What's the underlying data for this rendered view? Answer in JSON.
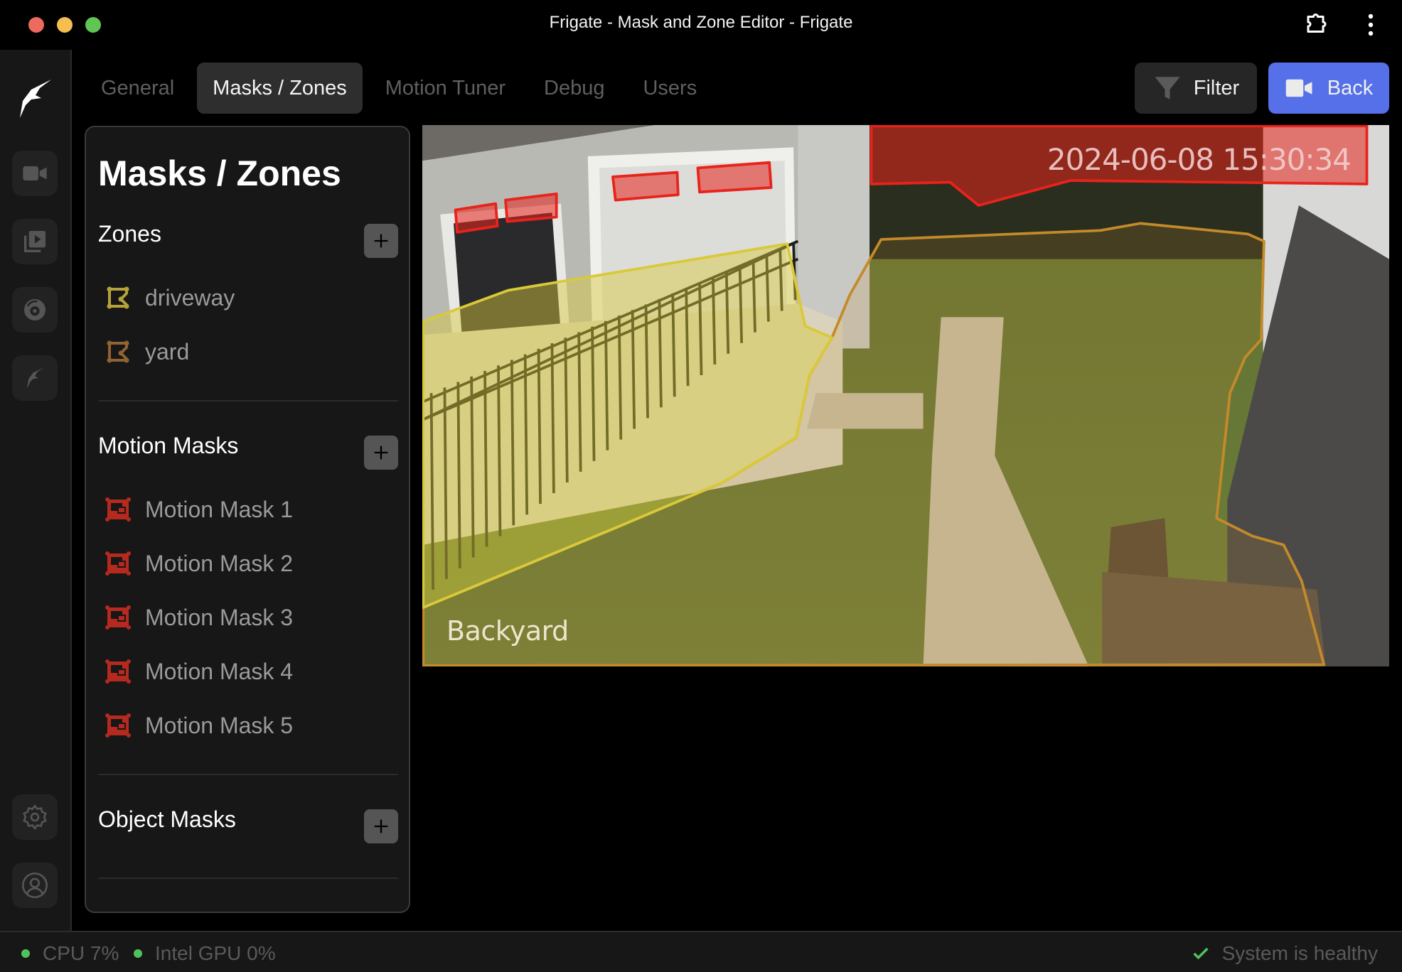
{
  "window": {
    "title": "Frigate - Mask and Zone Editor - Frigate"
  },
  "sidebar": {
    "items": [
      {
        "name": "live",
        "icon": "video-camera-icon"
      },
      {
        "name": "review",
        "icon": "play-library-icon"
      },
      {
        "name": "events",
        "icon": "radar-icon"
      },
      {
        "name": "frigate-plus",
        "icon": "frigate-bird-icon"
      }
    ],
    "bottom": [
      {
        "name": "settings",
        "icon": "gear-icon"
      },
      {
        "name": "account",
        "icon": "user-circle-icon"
      }
    ]
  },
  "tabs": [
    {
      "label": "General",
      "active": false
    },
    {
      "label": "Masks / Zones",
      "active": true
    },
    {
      "label": "Motion Tuner",
      "active": false
    },
    {
      "label": "Debug",
      "active": false
    },
    {
      "label": "Users",
      "active": false
    }
  ],
  "toolbar": {
    "filter_label": "Filter",
    "back_label": "Back",
    "back_color": "#5570e8"
  },
  "panel": {
    "title": "Masks / Zones",
    "zones": {
      "heading": "Zones",
      "items": [
        {
          "label": "driveway",
          "color": "#b5a33a"
        },
        {
          "label": "yard",
          "color": "#8f6332"
        }
      ]
    },
    "motion_masks": {
      "heading": "Motion Masks",
      "color": "#b5291f",
      "items": [
        {
          "label": "Motion Mask 1"
        },
        {
          "label": "Motion Mask 2"
        },
        {
          "label": "Motion Mask 3"
        },
        {
          "label": "Motion Mask 4"
        },
        {
          "label": "Motion Mask 5"
        }
      ]
    },
    "object_masks": {
      "heading": "Object Masks",
      "items": []
    }
  },
  "camera": {
    "name_overlay": "Backyard",
    "timestamp_overlay": "2024-06-08 15:30:34",
    "zone_colors": {
      "driveway": "#d9c93a",
      "yard": "#c48a2a",
      "mask": "#e8231c"
    }
  },
  "status": {
    "cpu": "CPU 7%",
    "gpu": "Intel GPU 0%",
    "health": "System is healthy",
    "ok_color": "#4fc35a"
  }
}
